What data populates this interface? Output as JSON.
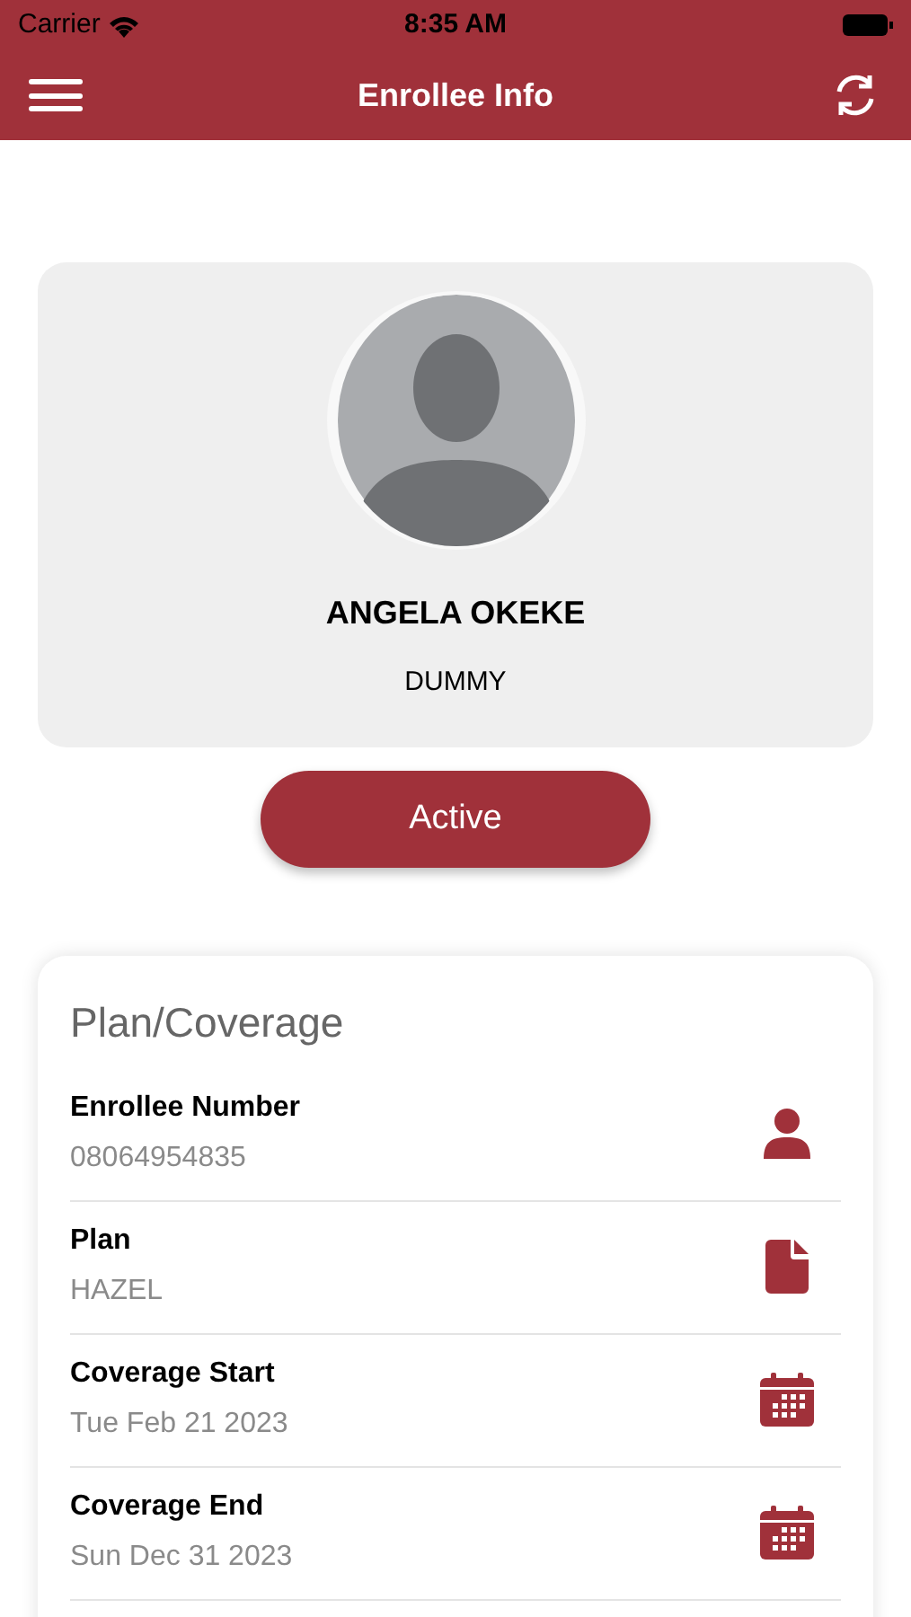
{
  "status_bar": {
    "carrier": "Carrier",
    "time": "8:35 AM"
  },
  "nav": {
    "title": "Enrollee Info"
  },
  "profile": {
    "name": "ANGELA OKEKE",
    "subtitle": "DUMMY"
  },
  "status_button": {
    "label": "Active"
  },
  "plan": {
    "title": "Plan/Coverage",
    "rows": [
      {
        "label": "Enrollee Number",
        "value": "08064954835",
        "kind": "person"
      },
      {
        "label": "Plan",
        "value": "HAZEL",
        "kind": "file"
      },
      {
        "label": "Coverage Start",
        "value": "Tue Feb 21 2023",
        "kind": "calendar"
      },
      {
        "label": "Coverage End",
        "value": "Sun Dec 31 2023",
        "kind": "calendar"
      }
    ]
  }
}
